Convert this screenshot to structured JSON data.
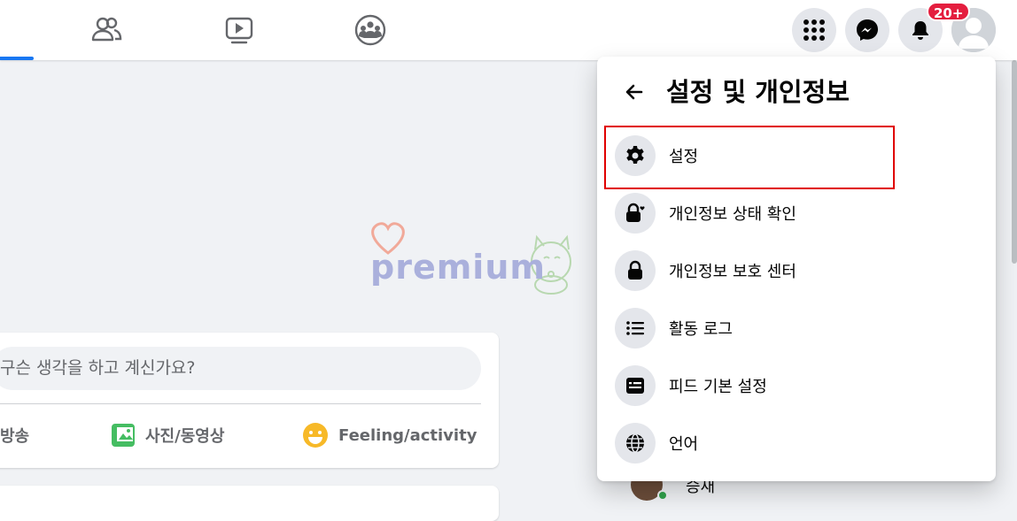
{
  "colors": {
    "accent": "#1877f2",
    "badge": "#e41e3f",
    "highlight": "#e00000",
    "online": "#31a24c"
  },
  "topbar": {
    "nav_icons": [
      "friends-icon",
      "watch-icon",
      "groups-icon"
    ],
    "actions": [
      "menu-grid-icon",
      "messenger-icon",
      "notifications-icon",
      "account-avatar"
    ],
    "notifications_badge": "20+"
  },
  "watermark": {
    "text": "premium"
  },
  "composer": {
    "placeholder": "무슨 생각을 하고 계신가요?",
    "visible_placeholder": "구슨 생각을 하고 계신가요?",
    "actions": [
      {
        "label": "방송",
        "icon": "live-video-icon"
      },
      {
        "label": "사진/동영상",
        "icon": "photo-icon"
      },
      {
        "label": "Feeling/activity",
        "icon": "smiley-icon"
      }
    ]
  },
  "contact": {
    "name": "승재"
  },
  "settings_menu": {
    "title": "설정 및 개인정보",
    "items": [
      {
        "label": "설정",
        "icon": "gear-icon",
        "highlighted": true
      },
      {
        "label": "개인정보 상태 확인",
        "icon": "lock-heart-icon"
      },
      {
        "label": "개인정보 보호 센터",
        "icon": "lock-icon"
      },
      {
        "label": "활동 로그",
        "icon": "list-icon"
      },
      {
        "label": "피드 기본 설정",
        "icon": "feed-icon"
      },
      {
        "label": "언어",
        "icon": "globe-icon"
      }
    ]
  }
}
